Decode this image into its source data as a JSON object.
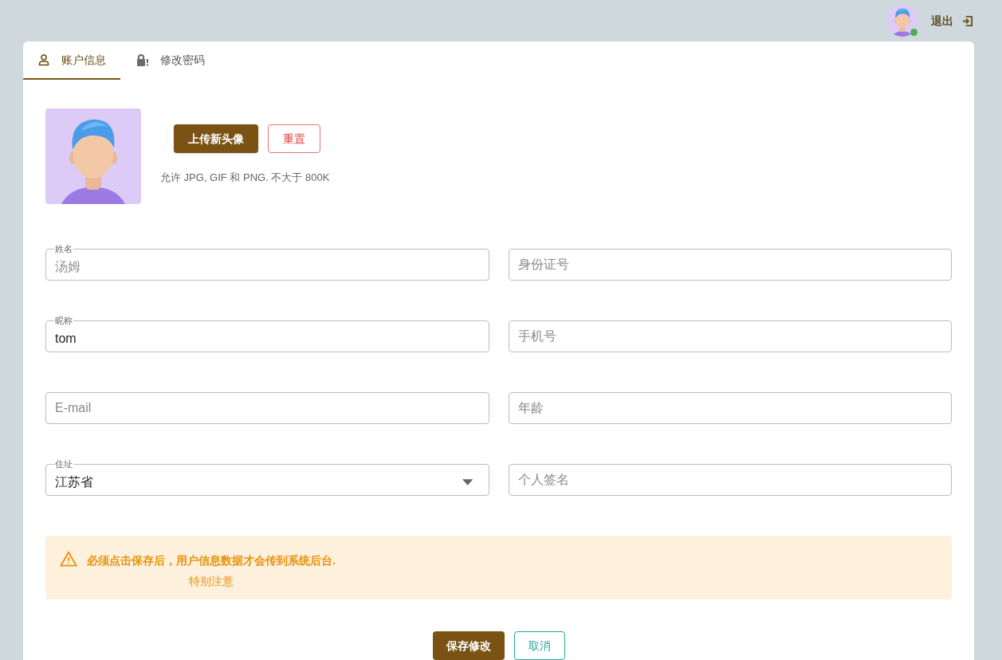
{
  "header": {
    "online": true,
    "logout": "退出"
  },
  "tabs": [
    {
      "label": "账户信息",
      "selected": true
    },
    {
      "label": "修改密码",
      "selected": false
    }
  ],
  "avatar": {
    "upload": "上传新头像",
    "reset": "重置",
    "hint": "允许 JPG, GIF 和 PNG. 不大于 800K"
  },
  "fields": [
    {
      "kind": "text",
      "label": "姓名",
      "value": "汤姆",
      "disabled": true
    },
    {
      "kind": "text",
      "placeholder": "身份证号"
    },
    {
      "kind": "text",
      "label": "昵称",
      "value": "tom",
      "disabled": false
    },
    {
      "kind": "text",
      "placeholder": "手机号"
    },
    {
      "kind": "text",
      "placeholder": "E-mail"
    },
    {
      "kind": "text",
      "placeholder": "年龄"
    },
    {
      "kind": "select",
      "label": "住址",
      "value": "江苏省",
      "disabled": false
    },
    {
      "kind": "text",
      "placeholder": "个人签名"
    }
  ],
  "alert": {
    "lines": [
      "必须点击保存后，用户信息数据才会传到系统后台.",
      "特别注意"
    ]
  },
  "actions": {
    "save": "保存修改",
    "cancel": "取消"
  }
}
